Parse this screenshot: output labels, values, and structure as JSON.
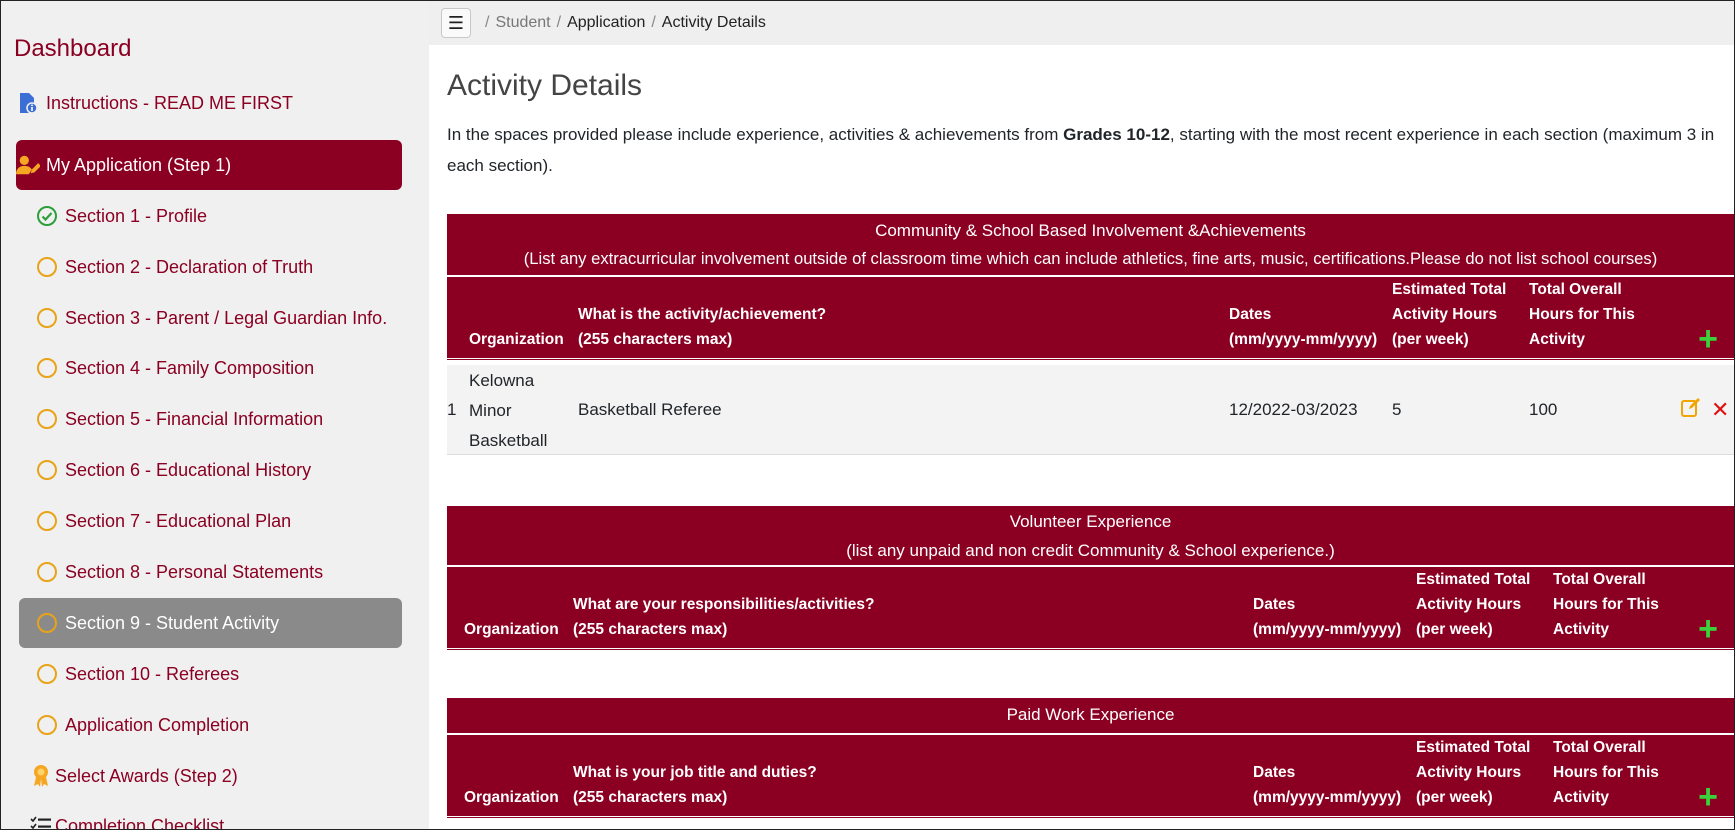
{
  "sidebar": {
    "title": "Dashboard",
    "items": [
      {
        "label": "Instructions - READ ME FIRST",
        "icon": "file-info-icon"
      },
      {
        "label": "My Application (Step 1)",
        "icon": "user-edit-icon"
      },
      {
        "label": "Section 1 - Profile",
        "icon": "check-circle-icon"
      },
      {
        "label": "Section 2 - Declaration of Truth",
        "icon": "circle-icon"
      },
      {
        "label": "Section 3 - Parent / Legal Guardian Info.",
        "icon": "circle-icon"
      },
      {
        "label": "Section 4 - Family Composition",
        "icon": "circle-icon"
      },
      {
        "label": "Section 5 - Financial Information",
        "icon": "circle-icon"
      },
      {
        "label": "Section 6 - Educational History",
        "icon": "circle-icon"
      },
      {
        "label": "Section 7 - Educational Plan",
        "icon": "circle-icon"
      },
      {
        "label": "Section 8 - Personal Statements",
        "icon": "circle-icon"
      },
      {
        "label": "Section 9 - Student Activity",
        "icon": "circle-icon"
      },
      {
        "label": "Section 10 - Referees",
        "icon": "circle-icon"
      },
      {
        "label": "Application Completion",
        "icon": "circle-icon"
      },
      {
        "label": "Select Awards (Step 2)",
        "icon": "award-icon"
      },
      {
        "label": "Completion Checklist",
        "icon": "checklist-icon"
      }
    ]
  },
  "breadcrumb": {
    "items": [
      "Student",
      "Application",
      "Activity Details"
    ]
  },
  "page": {
    "title": "Activity Details",
    "intro_before": "In the spaces provided please include experience, activities & achievements from ",
    "intro_bold": "Grades 10-12",
    "intro_after": ", starting with the most recent experience in each section (maximum 3 in each section)."
  },
  "sections": [
    {
      "title": "Community & School Based Involvement &Achievements",
      "subtitle": "(List any extracurricular involvement outside of classroom time which can include athletics, fine arts, music, certifications.Please do not list school courses)",
      "columns": {
        "org": "Organization",
        "what_1": "What is the activity/achievement?",
        "what_2": "(255 characters max)",
        "dates_1": "Dates",
        "dates_2": "(mm/yyyy-mm/yyyy)",
        "est_1": "Estimated Total",
        "est_2": "Activity Hours",
        "est_3": "(per week)",
        "total_1": "Total Overall",
        "total_2": "Hours for This",
        "total_3": "Activity"
      },
      "rows": [
        {
          "num": "1",
          "org_1": "Kelowna",
          "org_2": "Minor",
          "org_3": "Basketball",
          "what": "Basketball Referee",
          "dates": "12/2022-03/2023",
          "est": "5",
          "total": "100"
        }
      ]
    },
    {
      "title": "Volunteer Experience",
      "subtitle": "(list any unpaid and non credit Community & School experience.)",
      "columns": {
        "org": "Organization",
        "what_1": "What are your responsibilities/activities?",
        "what_2": "(255 characters max)",
        "dates_1": "Dates",
        "dates_2": "(mm/yyyy-mm/yyyy)",
        "est_1": "Estimated Total",
        "est_2": "Activity Hours",
        "est_3": "(per week)",
        "total_1": "Total Overall",
        "total_2": "Hours for This",
        "total_3": "Activity"
      }
    },
    {
      "title": "Paid Work Experience",
      "columns": {
        "org": "Organization",
        "what_1": "What is your job title and duties?",
        "what_2": "(255 characters max)",
        "dates_1": "Dates",
        "dates_2": "(mm/yyyy-mm/yyyy)",
        "est_1": "Estimated Total",
        "est_2": "Activity Hours",
        "est_3": "(per week)",
        "total_1": "Total Overall",
        "total_2": "Hours for This",
        "total_3": "Activity"
      }
    }
  ],
  "colors": {
    "brand": "#8b0022",
    "sidebar_bg": "#f0f0f0",
    "selected_bg": "#8a8a8a",
    "pending_circle": "#e8a317",
    "complete_check": "#2e9e3a",
    "add": "#3bd13b",
    "edit": "#f0a500",
    "delete": "#e01010"
  }
}
